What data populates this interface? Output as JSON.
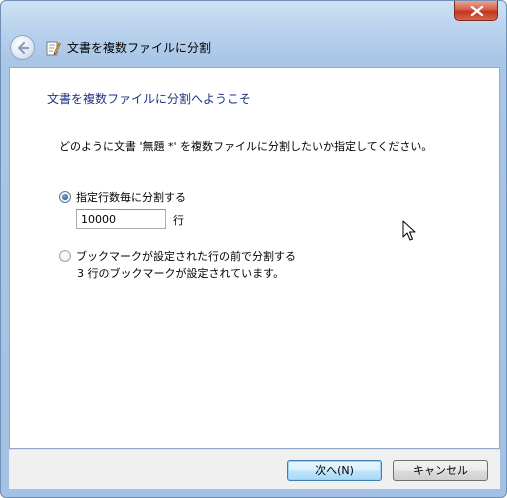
{
  "window": {
    "title": "文書を複数ファイルに分割"
  },
  "wizard": {
    "heading": "文書を複数ファイルに分割へようこそ",
    "description": "どのように文書 '無題 *' を複数ファイルに分割したいか指定してください。"
  },
  "options": {
    "by_lines": {
      "label": "指定行数毎に分割する",
      "checked": true,
      "value": "10000",
      "unit": "行"
    },
    "by_bookmark": {
      "label": "ブックマークが設定された行の前で分割する",
      "checked": false,
      "note": "3 行のブックマークが設定されています。"
    }
  },
  "buttons": {
    "next": "次へ(N)",
    "cancel": "キャンセル"
  },
  "icons": {
    "close": "close-icon",
    "back": "back-arrow-icon",
    "app": "document-pen-icon",
    "cursor": "mouse-pointer-icon"
  }
}
